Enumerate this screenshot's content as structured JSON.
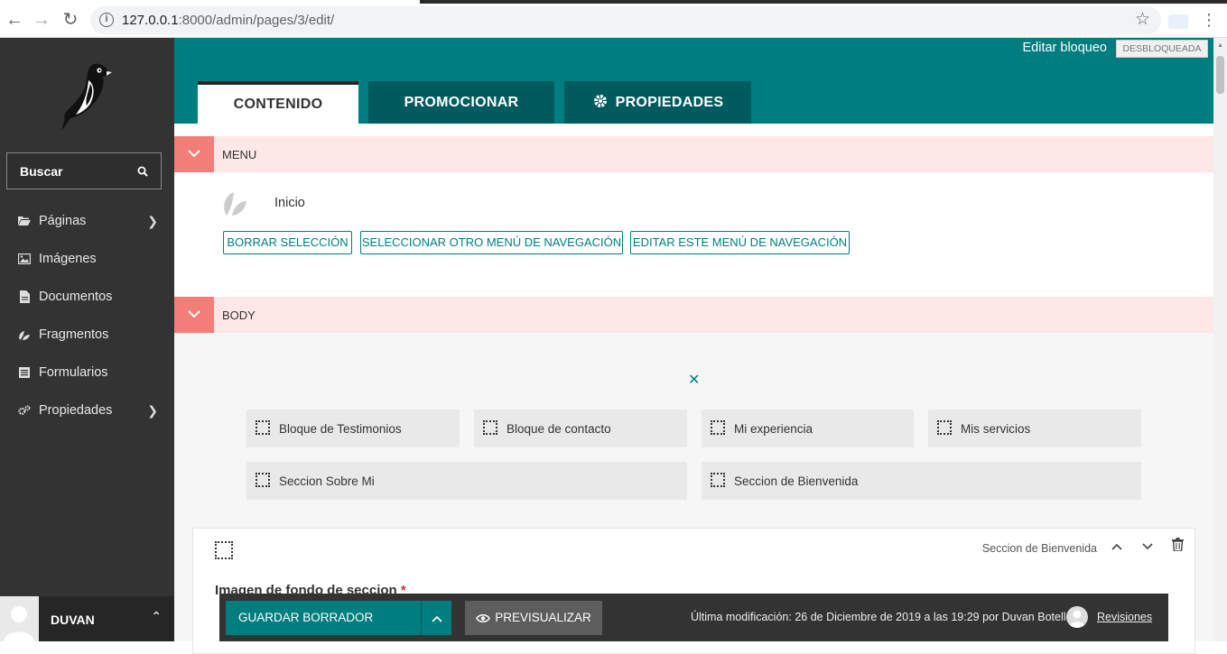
{
  "browser": {
    "url_host": "127.0.0.1",
    "url_rest": ":8000/admin/pages/3/edit/"
  },
  "sidebar": {
    "search_label": "Buscar",
    "items": [
      {
        "label": "Páginas",
        "icon": "folder-open-icon",
        "has_submenu": true
      },
      {
        "label": "Imágenes",
        "icon": "image-icon",
        "has_submenu": false
      },
      {
        "label": "Documentos",
        "icon": "document-icon",
        "has_submenu": false
      },
      {
        "label": "Fragmentos",
        "icon": "snippet-icon",
        "has_submenu": false
      },
      {
        "label": "Formularios",
        "icon": "form-icon",
        "has_submenu": false
      },
      {
        "label": "Propiedades",
        "icon": "cogs-icon",
        "has_submenu": true
      }
    ],
    "user_name": "DUVAN"
  },
  "header": {
    "lock_label": "Editar bloqueo",
    "lock_state": "DESBLOQUEADA",
    "tabs": [
      {
        "label": "CONTENIDO",
        "active": true
      },
      {
        "label": "PROMOCIONAR",
        "active": false
      },
      {
        "label": "PROPIEDADES",
        "active": false
      }
    ]
  },
  "menu_panel": {
    "title": "MENU",
    "selected_item": "Inicio",
    "buttons": [
      "BORRAR SELECCIÓN",
      "SELECCIONAR OTRO MENÚ DE NAVEGACIÓN",
      "EDITAR ESTE MENÚ DE NAVEGACIÓN"
    ]
  },
  "body_panel": {
    "title": "BODY",
    "block_choices": [
      "Bloque de Testimonios",
      "Bloque de contacto",
      "Mi experiencia",
      "Mis servicios",
      "Seccion Sobre Mi",
      "Seccion de Bienvenida"
    ],
    "block": {
      "type_label": "Seccion de Bienvenida",
      "field_label": "Imagen de fondo de seccion",
      "required_mark": "*"
    }
  },
  "footer": {
    "save_label": "GUARDAR BORRADOR",
    "preview_label": "PREVISUALIZAR",
    "last_modified": "Última modificación: 26 de Diciembre de 2019 a las 19:29 por Duvan Botello",
    "revisions_label": "Revisiones"
  },
  "colors": {
    "primary": "#007d7e",
    "sidebar": "#333333",
    "panel_header": "#fee7e7",
    "panel_toggle": "#f37e77"
  }
}
